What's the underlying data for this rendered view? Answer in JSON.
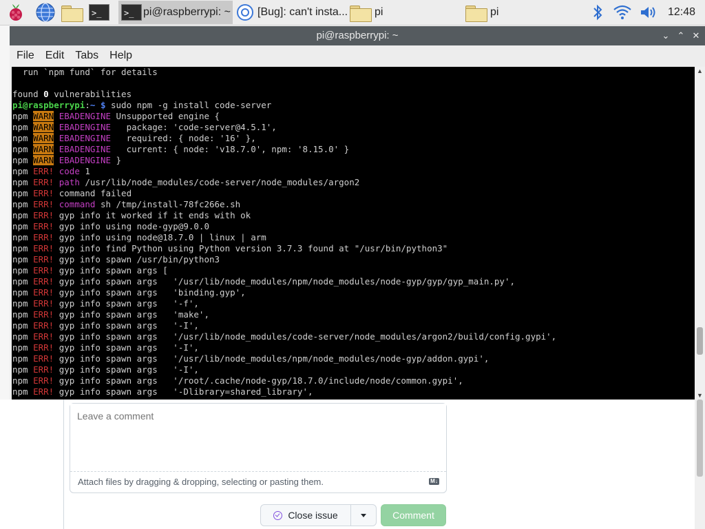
{
  "taskbar": {
    "tasks": [
      {
        "label": "pi@raspberrypi: ~",
        "icon": "terminal-icon"
      },
      {
        "label": "[Bug]: can't insta...",
        "icon": "chromium-icon"
      },
      {
        "label": "pi",
        "icon": "folder-icon"
      },
      {
        "label": "pi",
        "icon": "folder-icon"
      }
    ],
    "clock": "12:48"
  },
  "window": {
    "title": "pi@raspberrypi: ~",
    "menu": [
      "File",
      "Edit",
      "Tabs",
      "Help"
    ]
  },
  "terminal": {
    "lines": [
      "  run `npm fund` for details",
      "",
      "found 0 vulnerabilities",
      "pi@raspberrypi:~ $ sudo npm -g install code-server",
      "npm WARN EBADENGINE Unsupported engine {",
      "npm WARN EBADENGINE   package: 'code-server@4.5.1',",
      "npm WARN EBADENGINE   required: { node: '16' },",
      "npm WARN EBADENGINE   current: { node: 'v18.7.0', npm: '8.15.0' }",
      "npm WARN EBADENGINE }",
      "npm ERR! code 1",
      "npm ERR! path /usr/lib/node_modules/code-server/node_modules/argon2",
      "npm ERR! command failed",
      "npm ERR! command sh /tmp/install-78fc266e.sh",
      "npm ERR! gyp info it worked if it ends with ok",
      "npm ERR! gyp info using node-gyp@9.0.0",
      "npm ERR! gyp info using node@18.7.0 | linux | arm",
      "npm ERR! gyp info find Python using Python version 3.7.3 found at \"/usr/bin/python3\"",
      "npm ERR! gyp info spawn /usr/bin/python3",
      "npm ERR! gyp info spawn args [",
      "npm ERR! gyp info spawn args   '/usr/lib/node_modules/npm/node_modules/node-gyp/gyp/gyp_main.py',",
      "npm ERR! gyp info spawn args   'binding.gyp',",
      "npm ERR! gyp info spawn args   '-f',",
      "npm ERR! gyp info spawn args   'make',",
      "npm ERR! gyp info spawn args   '-I',",
      "npm ERR! gyp info spawn args   '/usr/lib/node_modules/code-server/node_modules/argon2/build/config.gypi',",
      "npm ERR! gyp info spawn args   '-I',",
      "npm ERR! gyp info spawn args   '/usr/lib/node_modules/npm/node_modules/node-gyp/addon.gypi',",
      "npm ERR! gyp info spawn args   '-I',",
      "npm ERR! gyp info spawn args   '/root/.cache/node-gyp/18.7.0/include/node/common.gypi',",
      "npm ERR! gyp info spawn args   '-Dlibrary=shared_library',"
    ]
  },
  "comment": {
    "placeholder": "Leave a comment",
    "attach_hint": "Attach files by dragging & dropping, selecting or pasting them.",
    "markdown_badge": "M↓",
    "close_issue_label": "Close issue",
    "comment_label": "Comment"
  },
  "colors": {
    "prompt_green": "#4ad34a",
    "path_blue": "#4e7ff0",
    "magenta": "#c43fc4",
    "err_red": "#d03636",
    "warn_bg": "#c97a10",
    "comment_green": "#94d3a2",
    "close_purple": "#8250df"
  }
}
